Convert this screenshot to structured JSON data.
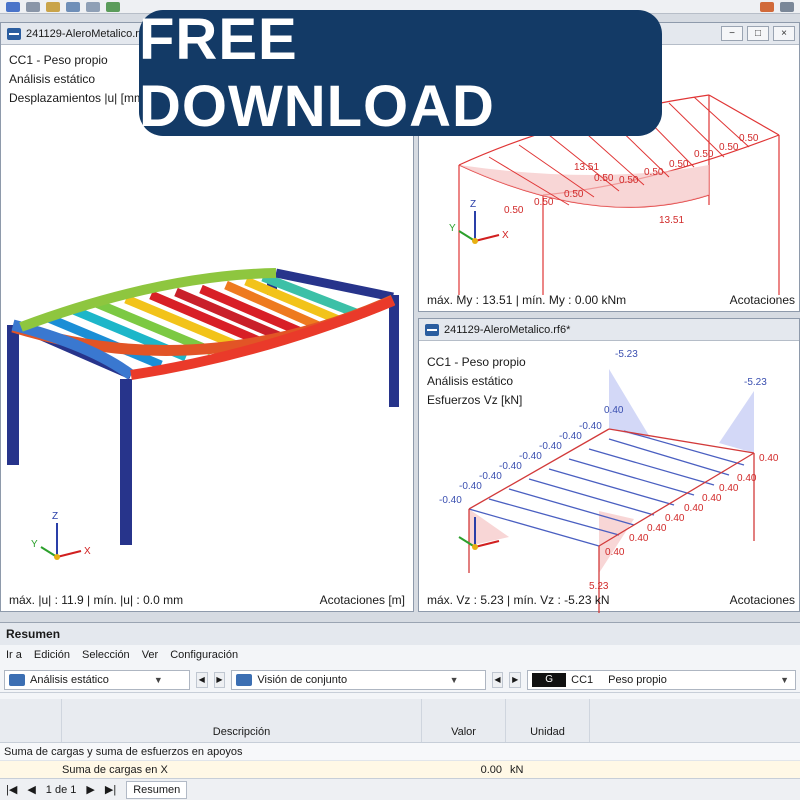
{
  "windows": {
    "left": {
      "title": "241129-AleroMetalico.rf",
      "lines": [
        "CC1 - Peso propio",
        "Análisis estático",
        "Desplazamientos |u| [mm]"
      ],
      "status_left": "máx. |u| : 11.9 | mín. |u| : 0.0 mm",
      "status_right": "Acotaciones [m]"
    },
    "top_right": {
      "status_left": "máx. My : 13.51 | mín. My : 0.00 kNm",
      "status_right": "Acotaciones",
      "labels": [
        "13.51",
        "13.51",
        "0.50",
        "0.50",
        "0.50",
        "0.50",
        "0.50",
        "0.50",
        "0.50",
        "0.50",
        "0.50",
        "0.50"
      ]
    },
    "bottom_right": {
      "title": "241129-AleroMetalico.rf6*",
      "lines": [
        "CC1 - Peso propio",
        "Análisis estático",
        "Esfuerzos Vz [kN]"
      ],
      "status_left": "máx. Vz : 5.23 | mín. Vz : -5.23 kN",
      "status_right": "Acotaciones",
      "labels": [
        "-5.23",
        "-5.23",
        "5.23",
        "-0.40",
        "0.40"
      ]
    }
  },
  "axis_labels": {
    "x": "X",
    "y": "Y",
    "z": "Z"
  },
  "banner": "FREE DOWNLOAD",
  "panel": {
    "title": "Resumen",
    "menu": [
      "Ir a",
      "Edición",
      "Selección",
      "Ver",
      "Configuración"
    ],
    "sel_analysis": "Análisis estático",
    "sel_view": "Visión de conjunto",
    "sel_g": "G",
    "sel_cc": "CC1",
    "sel_case": "Peso propio",
    "columns": [
      "Descripción",
      "Valor",
      "Unidad"
    ],
    "group": "Suma de cargas y suma de esfuerzos en apoyos",
    "rows": [
      {
        "desc": "Suma de cargas en X",
        "value": "0.00",
        "unit": "kN"
      }
    ],
    "pager": {
      "page": "1 de 1",
      "tab": "Resumen"
    }
  },
  "colors": {
    "title_bar": "#e4e8ee",
    "banner": "#133a66",
    "shear_blue": "#4a5fc1",
    "shear_red": "#d23a3a"
  }
}
